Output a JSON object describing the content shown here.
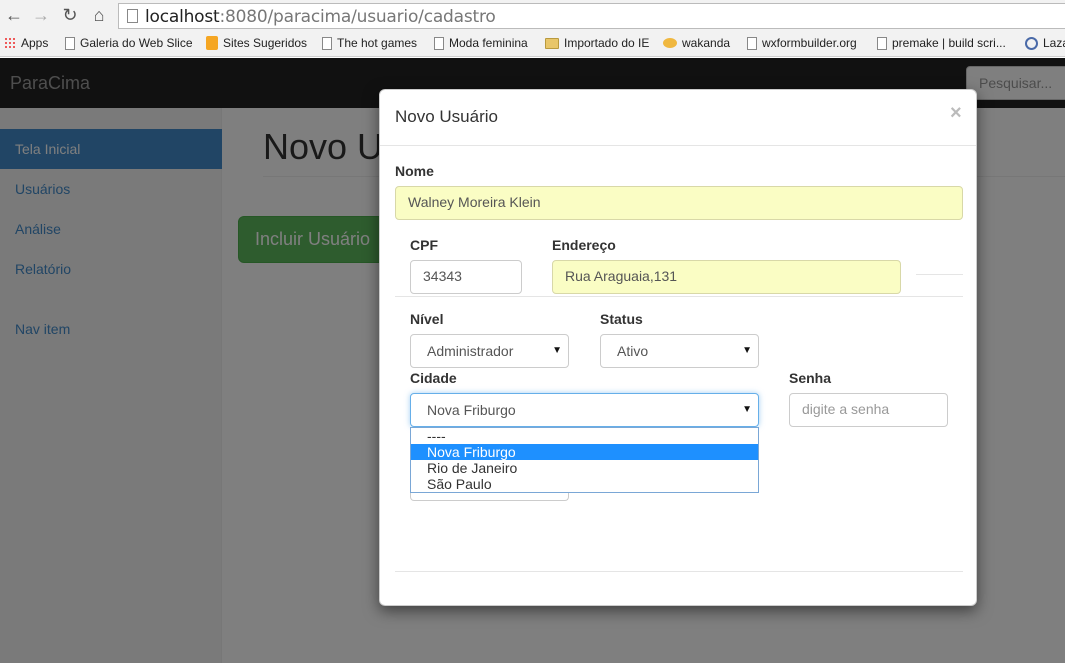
{
  "browser": {
    "url_host": "localhost",
    "url_rest": ":8080/paracima/usuario/cadastro",
    "bookmarks": [
      "Apps",
      "Galeria do Web Slice",
      "Sites Sugeridos",
      "The hot games",
      "Moda feminina",
      "Importado do IE",
      "wakanda",
      "wxformbuilder.org",
      "premake | build scri...",
      "Laza"
    ]
  },
  "navbar": {
    "brand": "ParaCima",
    "search_placeholder": "Pesquisar..."
  },
  "sidebar": {
    "items": [
      "Tela Inicial",
      "Usuários",
      "Análise",
      "Relatório",
      "Nav item"
    ]
  },
  "main": {
    "title": "Novo U",
    "incluir_button": "Incluir Usuário"
  },
  "modal": {
    "title": "Novo Usuário",
    "close": "×",
    "nome_label": "Nome",
    "nome_value": "Walney Moreira Klein",
    "cpf_label": "CPF",
    "cpf_value": "34343",
    "endereco_label": "Endereço",
    "endereco_value": "Rua Araguaia,131",
    "nivel_label": "Nível",
    "nivel_value": "Administrador",
    "status_label": "Status",
    "status_value": "Ativo",
    "cidade_label": "Cidade",
    "cidade_value": "Nova Friburgo",
    "cidade_options": [
      "----",
      "Nova Friburgo",
      "Rio de Janeiro",
      "São Paulo"
    ],
    "senha_label": "Senha",
    "senha_placeholder": "digite a senha"
  }
}
